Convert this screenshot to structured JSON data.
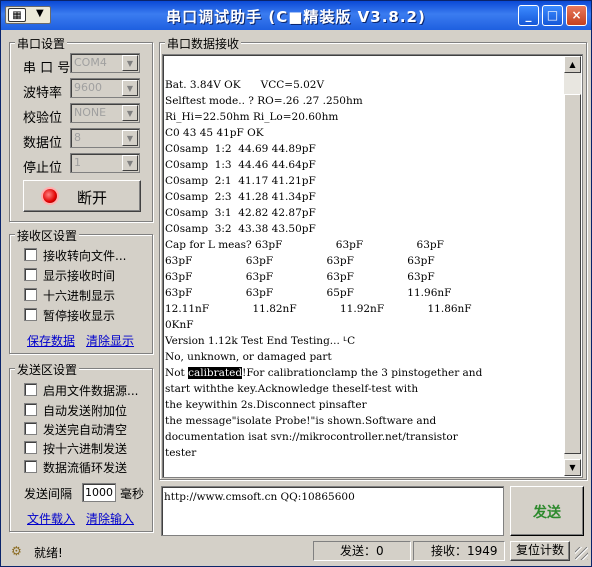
{
  "window": {
    "title": "串口调试助手 (C■精装版 V3.8.2)",
    "min": "_",
    "max": "□",
    "close": "×",
    "sysmenu_icon": "serial-port-icon"
  },
  "port_settings": {
    "legend": "串口设置",
    "rows": [
      {
        "label": "串 口 号",
        "value": "COM4"
      },
      {
        "label": "波特率",
        "value": "9600"
      },
      {
        "label": "校验位",
        "value": "NONE"
      },
      {
        "label": "数据位",
        "value": "8"
      },
      {
        "label": "停止位",
        "value": "1"
      }
    ],
    "open_button": "断开",
    "indicator_color": "#e00000"
  },
  "recv_settings": {
    "legend": "接收区设置",
    "options": [
      "接收转向文件...",
      "显示接收时间",
      "十六进制显示",
      "暂停接收显示"
    ],
    "save_link": "保存数据",
    "clear_link": "清除显示"
  },
  "send_settings": {
    "legend": "发送区设置",
    "options": [
      "启用文件数据源...",
      "自动发送附加位",
      "发送完自动清空",
      "按十六进制发送",
      "数据流循环发送"
    ],
    "interval_label": "发送间隔",
    "interval_value": "1000",
    "interval_unit": "毫秒",
    "load_link": "文件载入",
    "clear_link": "清除输入"
  },
  "recv_area": {
    "legend": "串口数据接收",
    "lines": [
      "Bat. 3.84V OK      VCC=5.02V",
      "Selftest mode.. ? RO=.26 .27 .250hm",
      "Ri_Hi=22.50hm Ri_Lo=20.60hm",
      "C0 43 45 41pF OK",
      "C0samp  1:2  44.69 44.89pF",
      "C0samp  1:3  44.46 44.64pF",
      "C0samp  2:1  41.17 41.21pF",
      "C0samp  2:3  41.28 41.34pF",
      "C0samp  3:1  42.82 42.87pF",
      "C0samp  3:2  43.38 43.50pF",
      "Cap for L meas? 63pF                63pF                63pF",
      "63pF                63pF                63pF                63pF",
      "63pF                63pF                63pF                63pF",
      "63pF                63pF                65pF                11.96nF",
      "12.11nF             11.82nF             11.92nF             11.86nF",
      "0KnF",
      "Version 1.12k Test End Testing... ᒻC",
      "No, unknown, or damaged part",
      "",
      "start withthe key.Acknowledge theself-test with",
      "the keywithin 2s.Disconnect pinsafter",
      "the message\"isolate Probe!\"is shown.Software and",
      "documentation isat svn://mikrocontroller.net/transistor",
      "tester"
    ],
    "selected_line": {
      "before": "Not ",
      "selected": "calibrated",
      "after": "!For calibrationclamp the 3 pinstogether and"
    }
  },
  "send_area": {
    "text": "http://www.cmsoft.cn QQ:10865600",
    "send_button": "发送"
  },
  "status_bar": {
    "ready": "就绪!",
    "sent": "发送：0",
    "received": "接收：1949",
    "reset_button": "复位计数"
  }
}
